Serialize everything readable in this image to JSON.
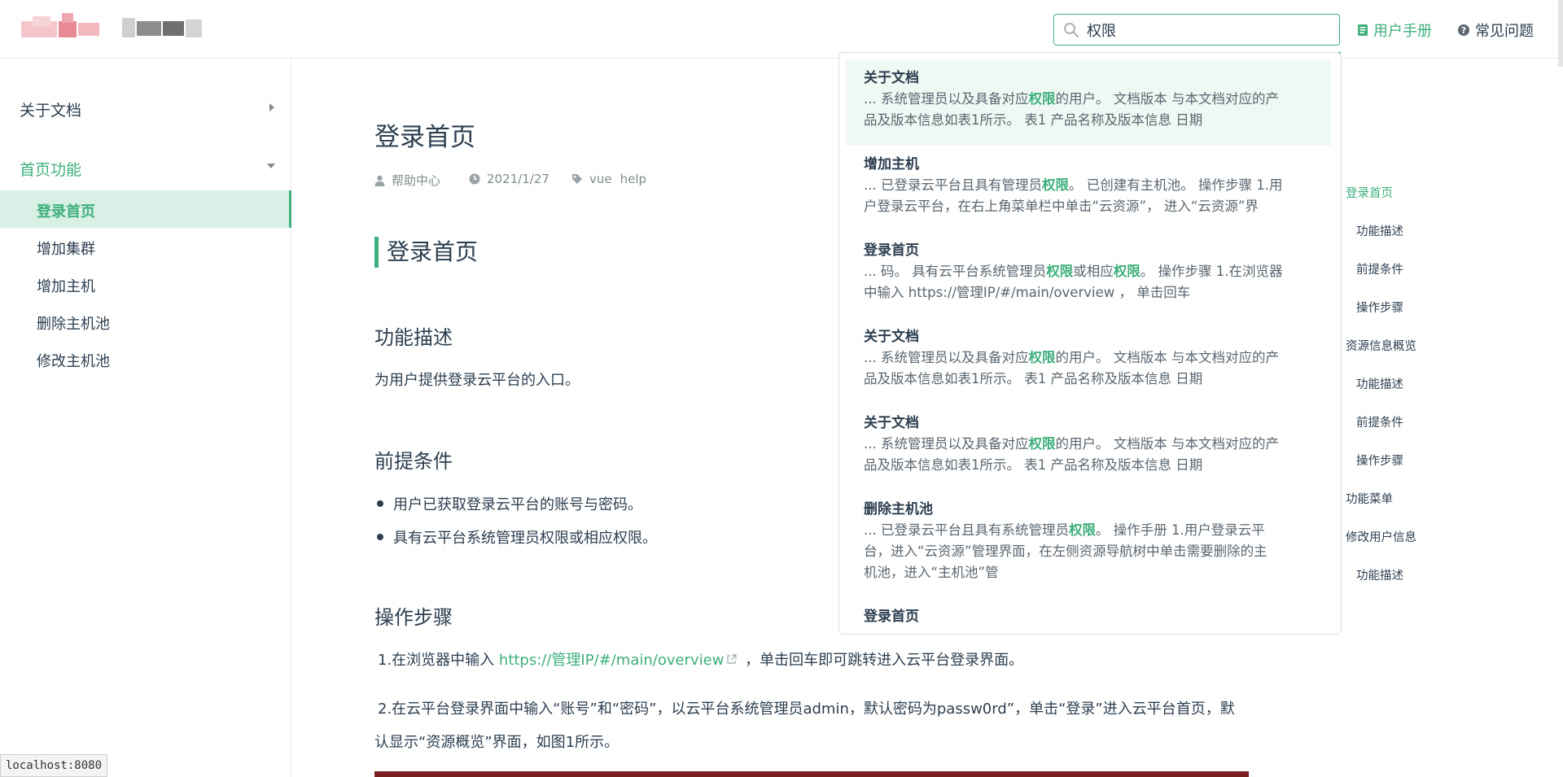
{
  "header": {
    "search": {
      "value": "权限",
      "placeholder": ""
    },
    "nav": {
      "manual_label": "用户手册",
      "faq_label": "常见问题"
    }
  },
  "sidebar": {
    "groups": [
      {
        "label": "关于文档",
        "expanded": false
      },
      {
        "label": "首页功能",
        "expanded": true
      }
    ],
    "items": [
      "登录首页",
      "增加集群",
      "增加主机",
      "删除主机池",
      "修改主机池"
    ],
    "active_item": "登录首页"
  },
  "page": {
    "title": "登录首页",
    "meta": {
      "author": "帮助中心",
      "date": "2021/1/27",
      "tags": [
        "vue",
        "help"
      ]
    },
    "h2": "登录首页",
    "sections": {
      "desc_heading": "功能描述",
      "desc_text": "为用户提供登录云平台的入口。",
      "pre_heading": "前提条件",
      "pre_items": [
        "用户已获取登录云平台的账号与密码。",
        "具有云平台系统管理员权限或相应权限。"
      ],
      "steps_heading": "操作步骤",
      "step1_before": "1.在浏览器中输入 ",
      "step1_link": "https://管理IP/#/main/overview",
      "step1_after": " ，单击回车即可跳转进入云平台登录界面。",
      "step2_line1": "2.在云平台登录界面中输入“账号”和“密码”，以云平台系统管理员admin，默认密码为passw0rd”，单击“登录”进入云平台首页，默",
      "step2_line2": "认显示“资源概览”界面，如图1所示。"
    }
  },
  "suggestions": [
    {
      "title": "关于文档",
      "lines": [
        [
          "... 系统管理员以及具备对应",
          "权限",
          "的用户。 文档版本 与本文档对应的产"
        ],
        [
          "品及版本信息如表1所示。 表1 产品名称及版本信息 日期"
        ]
      ]
    },
    {
      "title": "增加主机",
      "lines": [
        [
          "... 已登录云平台且具有管理员",
          "权限",
          "。 已创建有主机池。 操作步骤 1.用"
        ],
        [
          "户登录云平台，在右上角菜单栏中单击“云资源”， 进入“云资源”界"
        ]
      ]
    },
    {
      "title": "登录首页",
      "lines": [
        [
          "... 码。 具有云平台系统管理员",
          "权限",
          "或相应",
          "权限",
          "。 操作步骤 1.在浏览器"
        ],
        [
          "中输入 https://管理IP/#/main/overview ， 单击回车"
        ]
      ]
    },
    {
      "title": "关于文档",
      "lines": [
        [
          "... 系统管理员以及具备对应",
          "权限",
          "的用户。 文档版本 与本文档对应的产"
        ],
        [
          "品及版本信息如表1所示。 表1 产品名称及版本信息 日期"
        ]
      ]
    },
    {
      "title": "关于文档",
      "lines": [
        [
          "... 系统管理员以及具备对应",
          "权限",
          "的用户。 文档版本 与本文档对应的产"
        ],
        [
          "品及版本信息如表1所示。 表1 产品名称及版本信息 日期"
        ]
      ]
    },
    {
      "title": "删除主机池",
      "lines": [
        [
          "... 已登录云平台且具有系统管理员",
          "权限",
          "。 操作手册 1.用户登录云平"
        ],
        [
          "台，进入“云资源”管理界面，在左侧资源导航树中单击需要删除的主"
        ],
        [
          "机池，进入“主机池”管"
        ]
      ]
    },
    {
      "title": "登录首页",
      "lines": []
    }
  ],
  "toc": [
    {
      "label": "登录首页",
      "level": 1,
      "active": true
    },
    {
      "label": "功能描述",
      "level": 2,
      "active": false
    },
    {
      "label": "前提条件",
      "level": 2,
      "active": false
    },
    {
      "label": "操作步骤",
      "level": 2,
      "active": false
    },
    {
      "label": "资源信息概览",
      "level": 1,
      "active": false
    },
    {
      "label": "功能描述",
      "level": 2,
      "active": false
    },
    {
      "label": "前提条件",
      "level": 2,
      "active": false
    },
    {
      "label": "操作步骤",
      "level": 2,
      "active": false
    },
    {
      "label": "功能菜单",
      "level": 1,
      "active": false
    },
    {
      "label": "修改用户信息",
      "level": 1,
      "active": false
    },
    {
      "label": "功能描述",
      "level": 2,
      "active": false
    }
  ],
  "statusbar": {
    "url": "localhost:8080"
  },
  "icons": {
    "search": "search-icon",
    "manual": "book-icon",
    "faq": "question-circle-icon",
    "author": "user-icon",
    "date": "clock-icon",
    "tags": "tag-icon",
    "external": "external-link-icon"
  },
  "colors": {
    "accent": "#3eaf7c",
    "text": "#2c3e50",
    "muted": "#7f8c8d"
  }
}
